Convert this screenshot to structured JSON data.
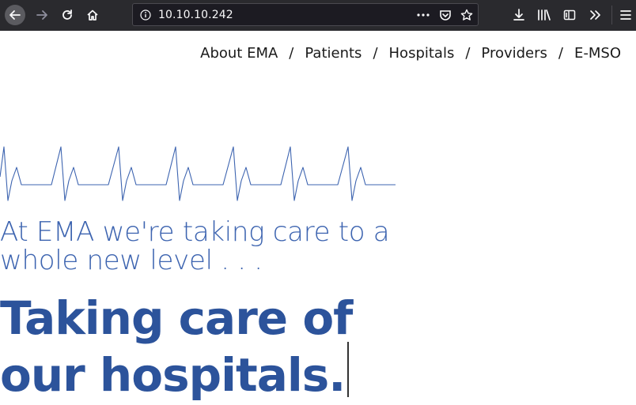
{
  "browser": {
    "url": "10.10.10.242",
    "icons": [
      "back-icon",
      "forward-icon",
      "reload-icon",
      "home-icon",
      "info-icon",
      "page-actions-icon",
      "pocket-icon",
      "bookmark-star-icon",
      "downloads-icon",
      "library-icon",
      "sidebar-icon",
      "overflow-icon",
      "menu-icon"
    ]
  },
  "nav": {
    "items": [
      "About EMA",
      "Patients",
      "Hospitals",
      "Providers",
      "E-MSO"
    ],
    "separator": "/"
  },
  "hero": {
    "tagline_line1": "At EMA we're taking care to a",
    "tagline_line2": "whole new level . . .",
    "headline_line1": "Taking care of",
    "headline_line2": "our hospitals."
  },
  "colors": {
    "chrome_bg": "#2a2a2e",
    "urlbar_bg": "#1c1b22",
    "accent_blue": "#3d64b0",
    "headline_blue": "#2c539b",
    "ekg_line": "#3d64b0"
  }
}
